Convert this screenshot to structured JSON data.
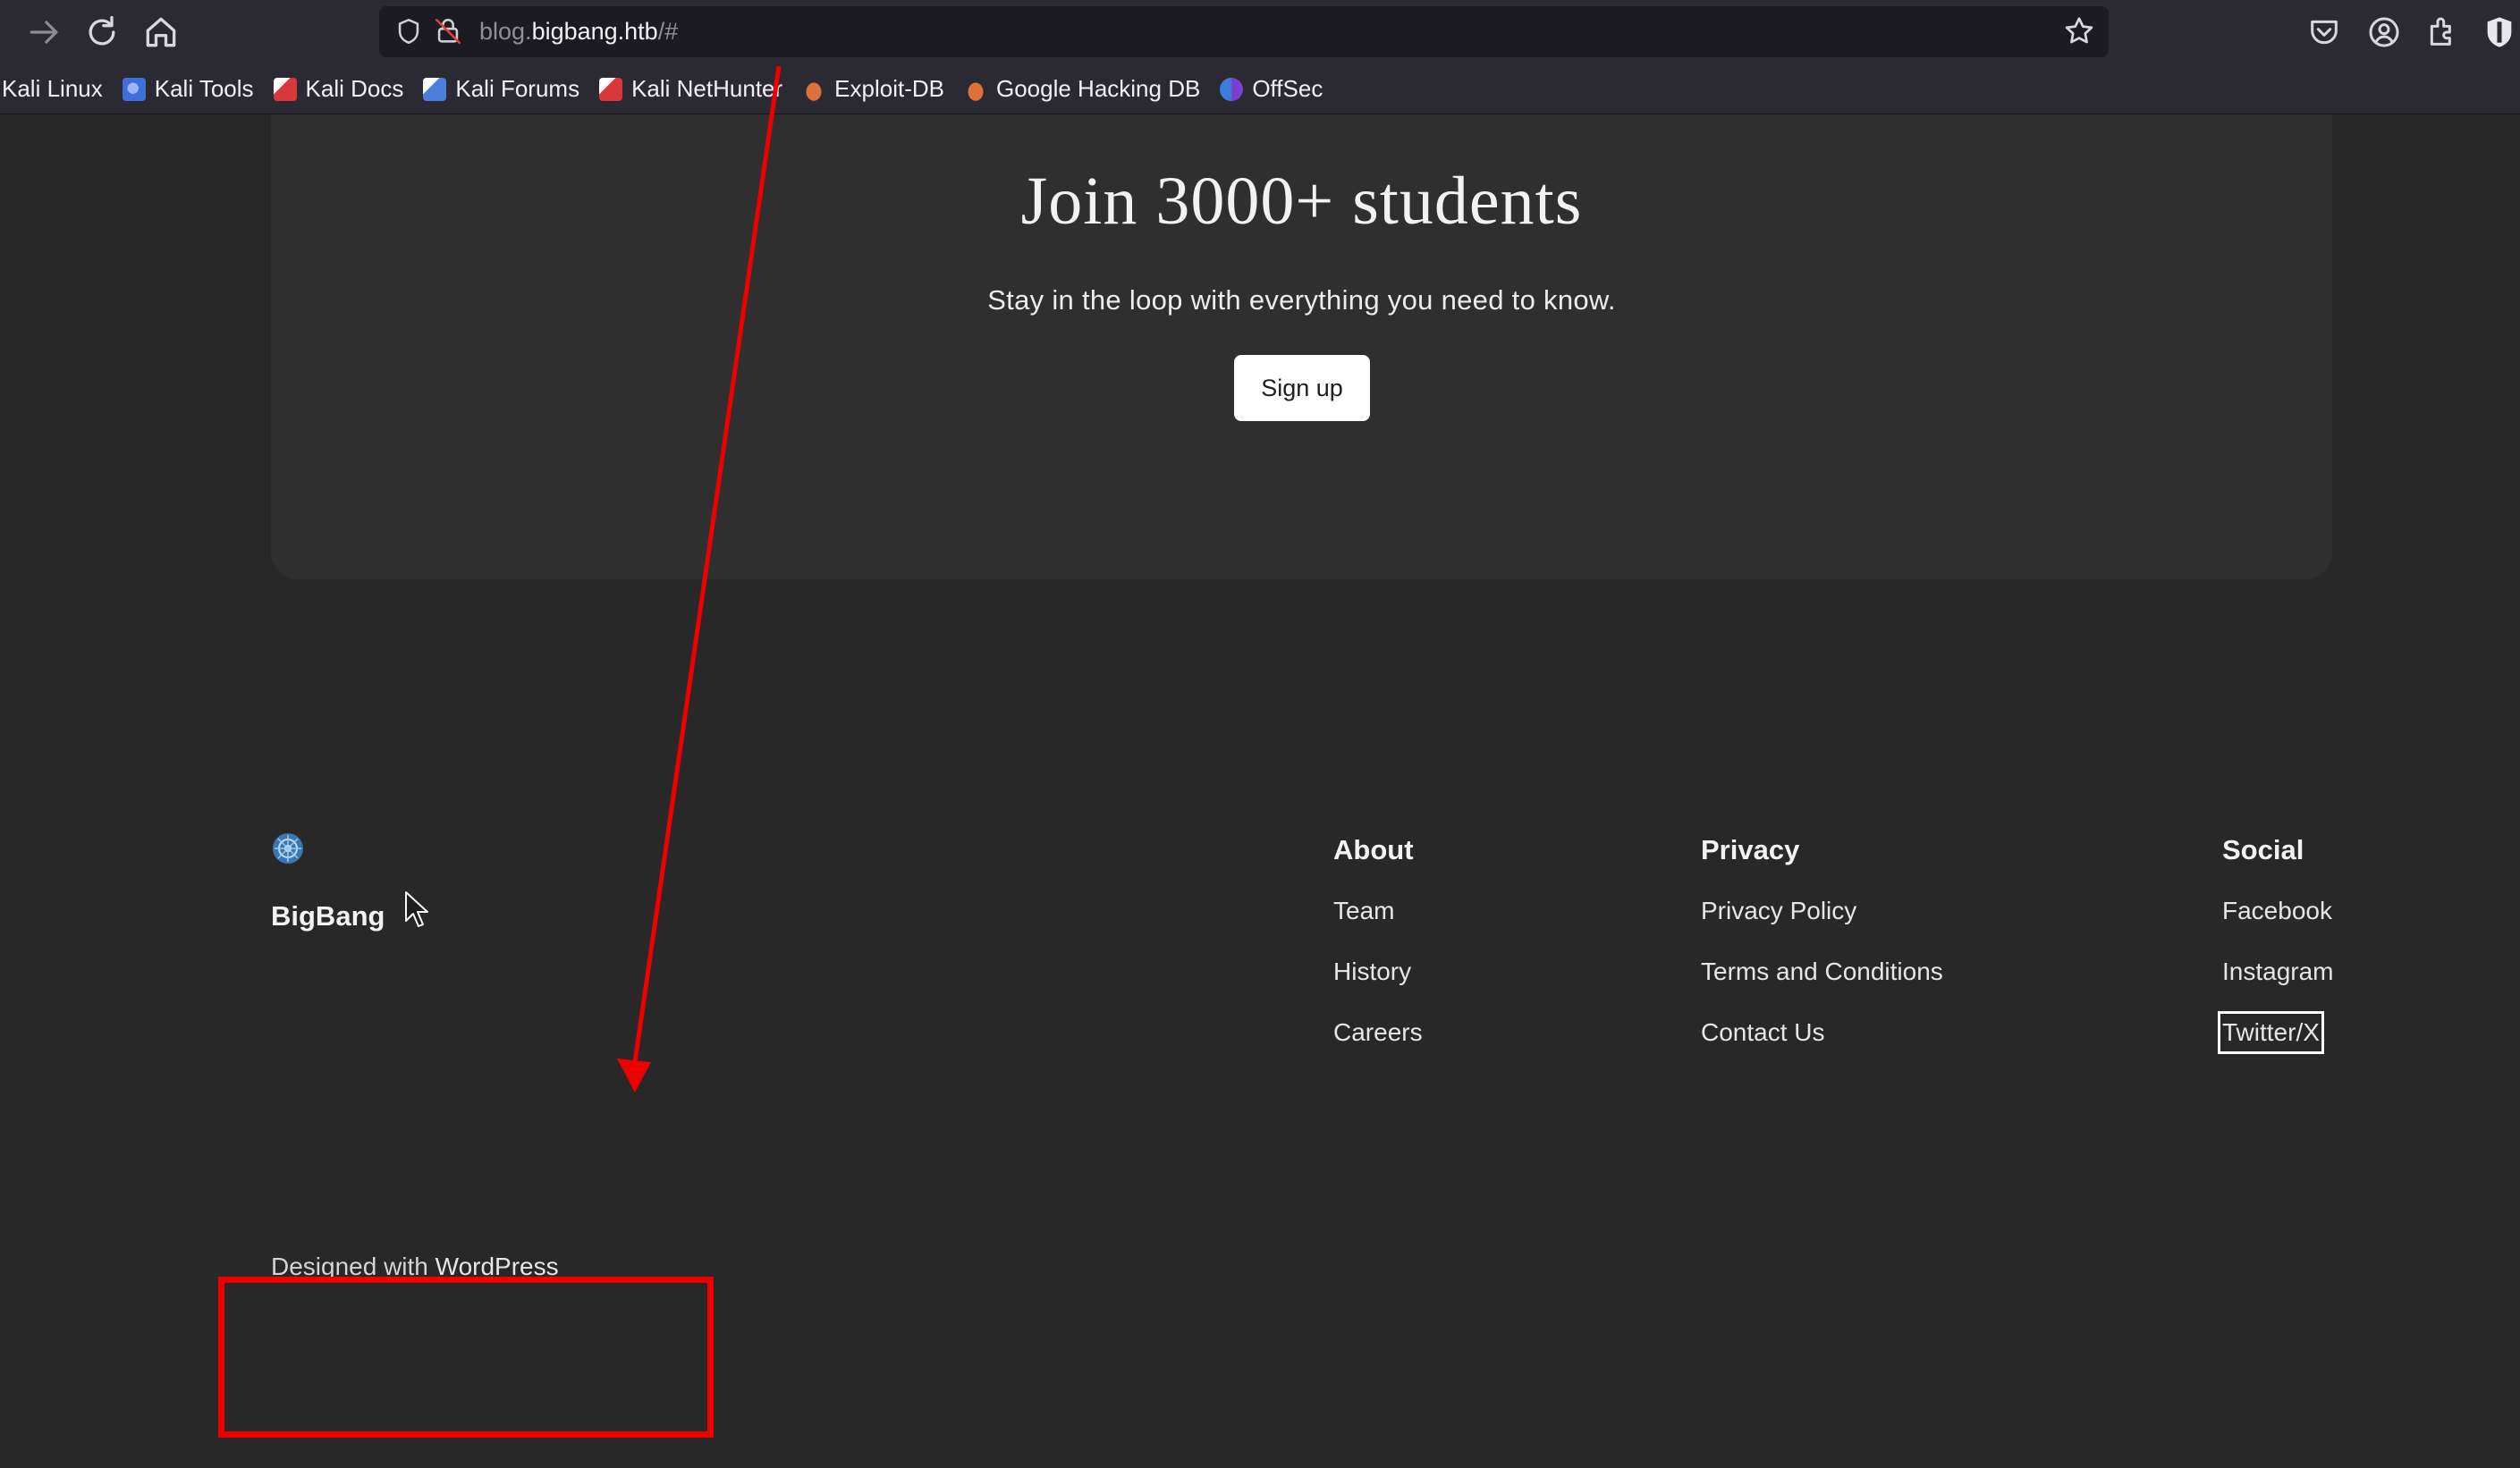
{
  "browser": {
    "url_prefix": "blog.",
    "url_host": "bigbang.htb",
    "url_suffix": "/#",
    "bookmarks": [
      {
        "label": "Kali Linux",
        "color": ""
      },
      {
        "label": "Kali Tools",
        "color": "#3f6fd8"
      },
      {
        "label": "Kali Docs",
        "color": "#d9383a"
      },
      {
        "label": "Kali Forums",
        "color": "#4a7fd9"
      },
      {
        "label": "Kali NetHunter",
        "color": "#d9383a"
      },
      {
        "label": "Exploit-DB",
        "color": "#e0703a"
      },
      {
        "label": "Google Hacking DB",
        "color": "#e0703a"
      },
      {
        "label": "OffSec",
        "color": "#3d7ddc"
      }
    ]
  },
  "cta": {
    "title": "Join 3000+ students",
    "subtitle": "Stay in the loop with everything you need to know.",
    "button": "Sign up"
  },
  "footer": {
    "site_name": "BigBang",
    "columns": [
      {
        "heading": "About",
        "links": [
          "Team",
          "History",
          "Careers"
        ]
      },
      {
        "heading": "Privacy",
        "links": [
          "Privacy Policy",
          "Terms and Conditions",
          "Contact Us"
        ]
      },
      {
        "heading": "Social",
        "links": [
          "Facebook",
          "Instagram",
          "Twitter/X"
        ]
      }
    ],
    "credits_prefix": "Designed with ",
    "credits_link": "WordPress"
  },
  "annotation": {
    "color": "#ee0000"
  }
}
